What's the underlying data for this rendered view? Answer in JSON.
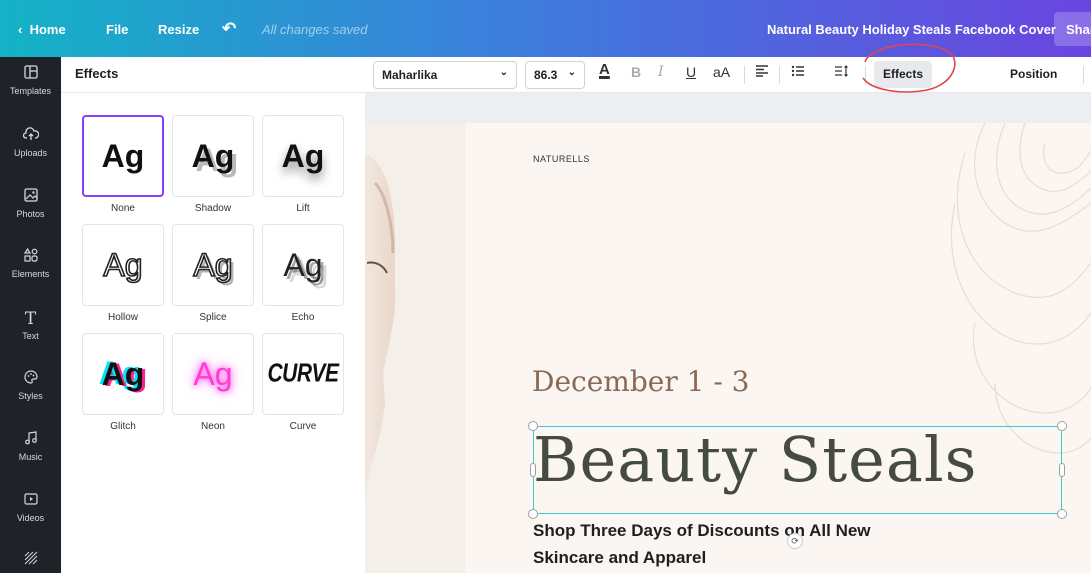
{
  "topbar": {
    "home": "Home",
    "file": "File",
    "resize": "Resize",
    "saved_status": "All changes saved",
    "document_title": "Natural Beauty Holiday Steals Facebook Cover",
    "share": "Shar"
  },
  "sidebar": {
    "items": [
      {
        "label": "Templates",
        "icon": "templates-icon"
      },
      {
        "label": "Uploads",
        "icon": "uploads-icon"
      },
      {
        "label": "Photos",
        "icon": "photos-icon"
      },
      {
        "label": "Elements",
        "icon": "elements-icon"
      },
      {
        "label": "Text",
        "icon": "text-icon"
      },
      {
        "label": "Styles",
        "icon": "styles-icon"
      },
      {
        "label": "Music",
        "icon": "music-icon"
      },
      {
        "label": "Videos",
        "icon": "videos-icon"
      }
    ]
  },
  "panel": {
    "title": "Effects",
    "effects": [
      {
        "label": "None",
        "sample": "Ag",
        "selected": true
      },
      {
        "label": "Shadow",
        "sample": "Ag"
      },
      {
        "label": "Lift",
        "sample": "Ag"
      },
      {
        "label": "Hollow",
        "sample": "Ag"
      },
      {
        "label": "Splice",
        "sample": "Ag"
      },
      {
        "label": "Echo",
        "sample": "Ag"
      },
      {
        "label": "Glitch",
        "sample": "Ag"
      },
      {
        "label": "Neon",
        "sample": "Ag"
      },
      {
        "label": "Curve",
        "sample": "CURVE"
      }
    ]
  },
  "toolbar": {
    "font": "Maharlika",
    "size": "86.3",
    "color_letter": "A",
    "bold": "B",
    "italic": "I",
    "underline": "U",
    "case": "aA",
    "effects": "Effects",
    "position": "Position"
  },
  "design": {
    "brand": "NATURELLS",
    "dates": "December 1 - 3",
    "headline": "Beauty Steals",
    "subtitle_line1": "Shop Three Days of Discounts on All New",
    "subtitle_line2": "Skincare and Apparel"
  },
  "colors": {
    "accent_purple": "#8b3dff",
    "selection_cyan": "#3ec6d4",
    "annotation_red": "#e0464f"
  }
}
